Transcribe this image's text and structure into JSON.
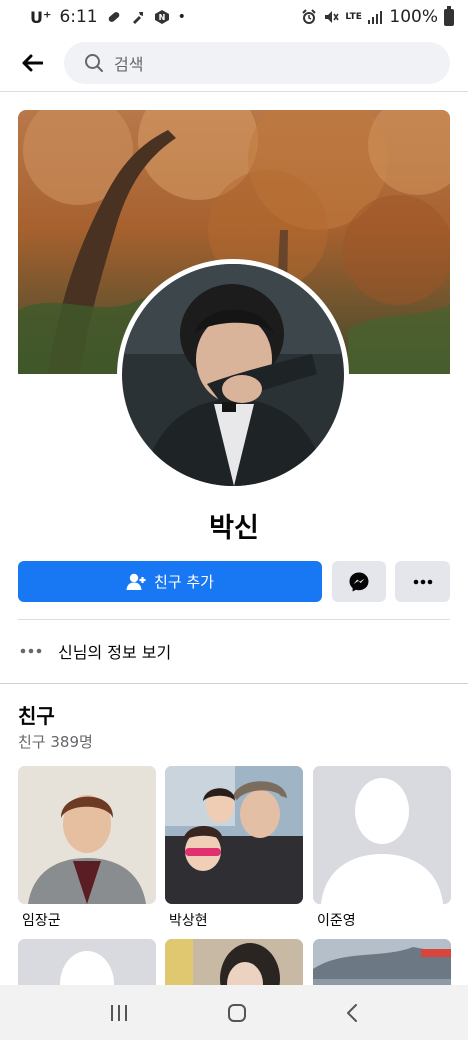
{
  "status_bar": {
    "carrier": "U⁺",
    "time": "6:11",
    "network": "LTE",
    "battery": "100%"
  },
  "header": {
    "search_placeholder": "검색"
  },
  "profile": {
    "name": "박신",
    "add_friend_label": "친구 추가",
    "info_label": "신님의 정보 보기"
  },
  "friends": {
    "title": "친구",
    "count_label": "친구 389명",
    "items": [
      {
        "name": "임장군"
      },
      {
        "name": "박상현"
      },
      {
        "name": "이준영"
      },
      {
        "name": ""
      },
      {
        "name": ""
      },
      {
        "name": ""
      }
    ]
  },
  "colors": {
    "primary": "#1877f2",
    "secondary_button": "#e4e6eb",
    "search_bg": "#f0f2f5"
  }
}
